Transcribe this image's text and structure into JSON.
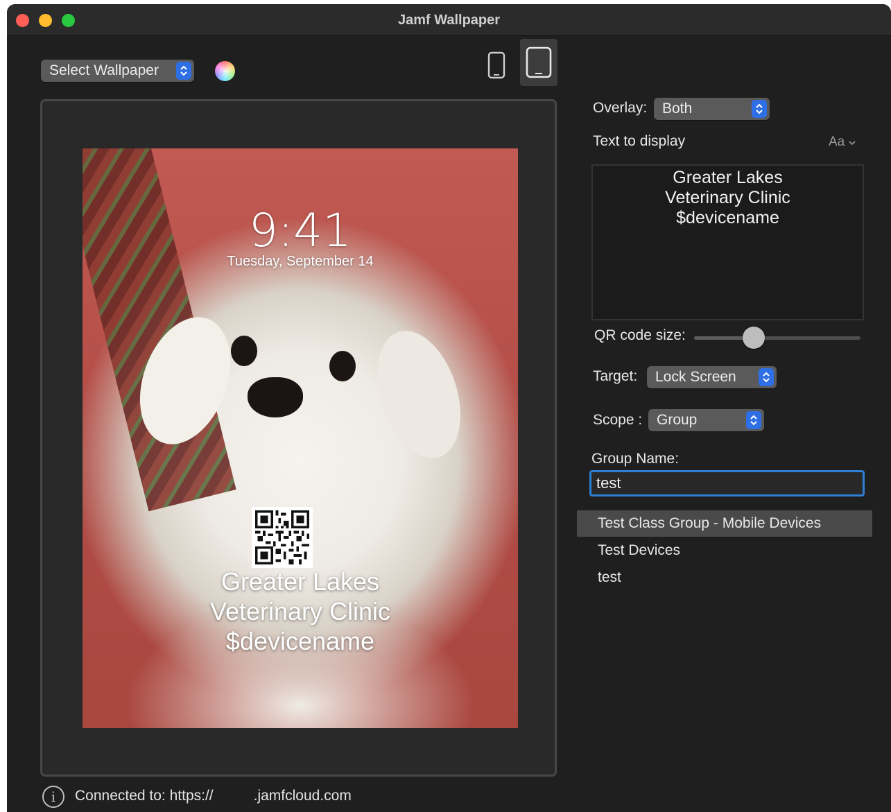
{
  "window": {
    "title": "Jamf Wallpaper"
  },
  "toolbar": {
    "wallpaper_popup": "Select Wallpaper",
    "color_icon": "color-wheel-icon",
    "device_phone_icon": "iphone-icon",
    "device_tablet_icon": "ipad-icon",
    "selected_device": "iPad"
  },
  "preview": {
    "time": "9:41",
    "date": "Tuesday, September 14",
    "overlay_lines": [
      "Greater Lakes",
      "Veterinary Clinic",
      "$devicename"
    ],
    "qr_icon": "qr-code-icon"
  },
  "settings": {
    "overlay_label": "Overlay:",
    "overlay_value": "Both",
    "text_label": "Text to display",
    "font_button": "Aa",
    "text_lines": [
      "Greater Lakes",
      "Veterinary Clinic",
      "$devicename"
    ],
    "qr_size_label": "QR code size:",
    "qr_size_value": 0.36,
    "target_label": "Target:",
    "target_value": "Lock Screen",
    "scope_label": "Scope :",
    "scope_value": "Group",
    "group_name_label": "Group Name:",
    "group_name_value": "test",
    "suggestions": [
      "Test Class Group - Mobile Devices",
      "Test Devices",
      "test"
    ],
    "selected_suggestion": 0
  },
  "status": {
    "info_icon": "info-icon",
    "connected_prefix": "Connected to: https://",
    "connected_suffix": ".jamfcloud.com"
  },
  "colors": {
    "accent": "#2f6fe6",
    "focus_ring": "#2e7fd6",
    "window_bg": "#1f1f1f",
    "close": "#ff5f57",
    "minimize": "#febc2e",
    "zoom": "#28c840"
  }
}
